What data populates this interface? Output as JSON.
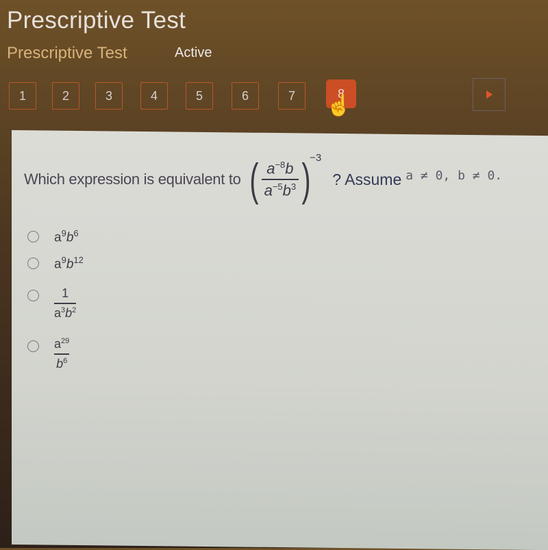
{
  "header": {
    "title": "Prescriptive Test",
    "subtitle": "Prescriptive Test",
    "status": "Active"
  },
  "nav": {
    "questions": [
      "1",
      "2",
      "3",
      "4",
      "5",
      "6",
      "7",
      "8"
    ],
    "active_question": "8",
    "next_icon": "play-triangle-icon"
  },
  "question": {
    "prompt": "Which expression is equivalent to",
    "expression": {
      "numerator": {
        "a_exp": "−8",
        "b_exp": ""
      },
      "denominator": {
        "a_exp": "−5",
        "b_exp": "3"
      },
      "outer_exponent": "−3"
    },
    "assume_label": "? Assume",
    "assume_condition": "a ≠ 0, b ≠ 0."
  },
  "options": [
    {
      "type": "product",
      "a_exp": "9",
      "b_exp": "6"
    },
    {
      "type": "product",
      "a_exp": "9",
      "b_exp": "12"
    },
    {
      "type": "fraction",
      "numerator": "1",
      "den_a_exp": "3",
      "den_b_exp": "2"
    },
    {
      "type": "fraction",
      "num_a_exp": "29",
      "den_b_exp": "6"
    }
  ],
  "colors": {
    "accent": "#cc4e25",
    "nav_border": "#b6582a",
    "subtitle": "#d8b27a"
  }
}
